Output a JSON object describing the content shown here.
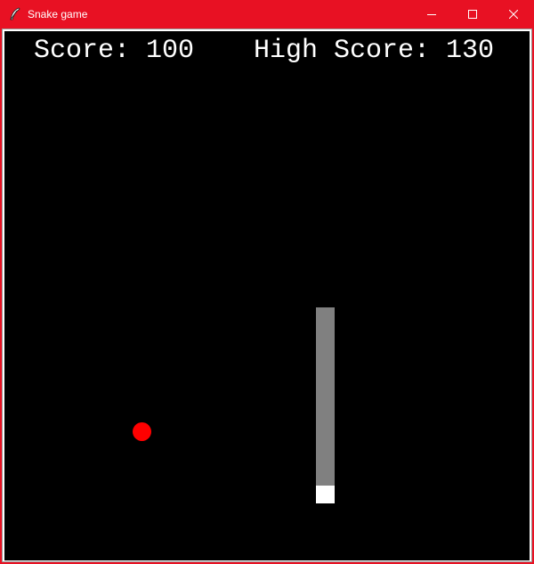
{
  "window": {
    "title": "Snake game",
    "title_bar_color": "#e81123",
    "controls": {
      "minimize_icon": "minimize-icon",
      "maximize_icon": "maximize-icon",
      "close_icon": "close-icon"
    },
    "app_icon": "feather-icon"
  },
  "scoreboard": {
    "score_text": "Score: 100",
    "high_score_text": "High Score: 130"
  },
  "game": {
    "background_color": "#000000",
    "food": {
      "color": "#ff0000",
      "shape": "circle"
    },
    "snake": {
      "body_color": "#808080",
      "head_color": "#ffffff",
      "direction": "down",
      "body_segment_count": 10
    }
  }
}
